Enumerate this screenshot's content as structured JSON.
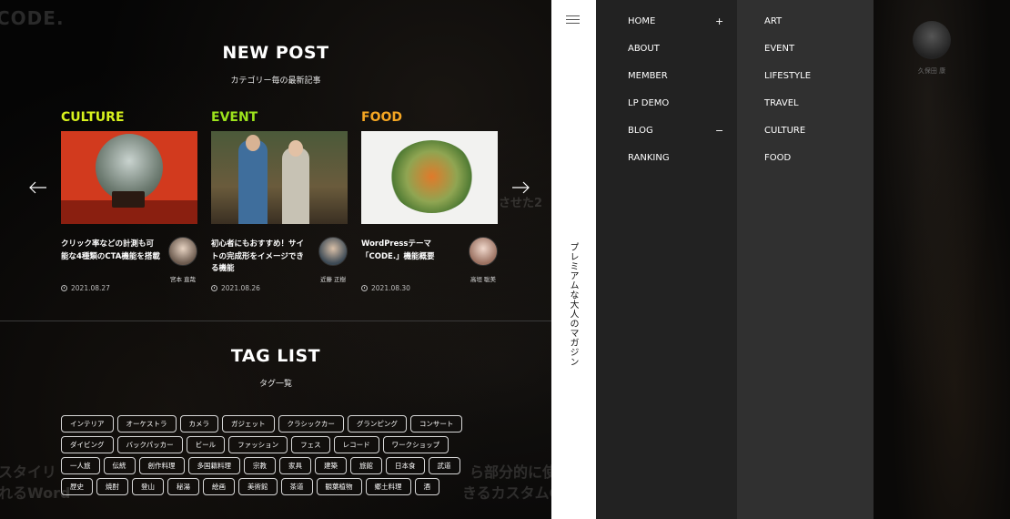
{
  "background": {
    "logo_fragment": "CODE.",
    "new_post": {
      "title": "NEW POST",
      "subtitle": "カテゴリー毎の最新記事",
      "cards": [
        {
          "category": "CULTURE",
          "category_color": "#d8f21d",
          "title": "クリック率などの計測も可能な4種類のCTA機能を搭載",
          "author": "宮本 直哉",
          "date": "2021.08.27"
        },
        {
          "category": "EVENT",
          "category_color": "#9ce31c",
          "title": "初心者にもおすすめ！サイトの完成形をイメージできる機能",
          "author": "近藤 正樹",
          "date": "2021.08.26"
        },
        {
          "category": "FOOD",
          "category_color": "#f5a623",
          "title": "WordPressテーマ「CODE.」機能概要",
          "author": "高垣 聡美",
          "date": "2021.08.30"
        }
      ]
    },
    "tag_list": {
      "title": "TAG LIST",
      "subtitle": "タグ一覧",
      "rows": [
        [
          "インテリア",
          "オーケストラ",
          "カメラ",
          "ガジェット",
          "クラシックカー",
          "グランピング",
          "コンサート"
        ],
        [
          "ダイビング",
          "バックパッカー",
          "ビール",
          "ファッション",
          "フェス",
          "レコード",
          "ワークショップ"
        ],
        [
          "一人旅",
          "伝統",
          "創作料理",
          "多国籍料理",
          "宗教",
          "家具",
          "建築",
          "旅館",
          "日本食",
          "武道"
        ],
        [
          "歴史",
          "焼酎",
          "登山",
          "秘湯",
          "絵画",
          "美術館",
          "茶道",
          "観葉植物",
          "郷土料理",
          "酒"
        ]
      ]
    },
    "ghost": {
      "mid_right": "させた2",
      "bottom_left": "スタイリ",
      "bottom_left2": "れるWord",
      "bottom_mid": "ら部分的に使",
      "bottom_mid2": "きるカスタムC"
    },
    "right_author": "久保田 康"
  },
  "drawer": {
    "tagline": "プレミアムな大人のマガジン",
    "nav_primary": [
      {
        "label": "HOME",
        "sign": "+"
      },
      {
        "label": "ABOUT",
        "sign": ""
      },
      {
        "label": "MEMBER",
        "sign": ""
      },
      {
        "label": "LP DEMO",
        "sign": ""
      },
      {
        "label": "BLOG",
        "sign": "−"
      },
      {
        "label": "RANKING",
        "sign": ""
      }
    ],
    "nav_blog_categories": [
      "ART",
      "EVENT",
      "LIFESTYLE",
      "TRAVEL",
      "CULTURE",
      "FOOD"
    ]
  }
}
